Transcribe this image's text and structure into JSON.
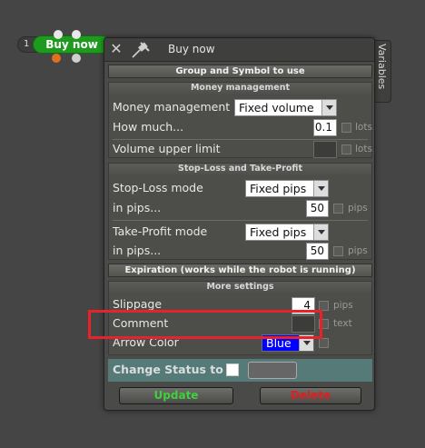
{
  "node": {
    "index": "1",
    "label": "Buy now"
  },
  "window": {
    "title": "Buy now",
    "side_tab": "Variables"
  },
  "sections": {
    "group_symbol": "Group and Symbol to use",
    "money": {
      "title": "Money management",
      "money_mgmt_label": "Money management",
      "money_mgmt_value": "Fixed volume",
      "how_much_label": "How much...",
      "how_much_value": "0.1",
      "how_much_unit": "lots",
      "volume_limit_label": "Volume upper limit",
      "volume_limit_unit": "lots"
    },
    "sltp": {
      "title": "Stop-Loss and Take-Profit",
      "sl_mode_label": "Stop-Loss mode",
      "sl_mode_value": "Fixed pips",
      "sl_pips_label": "in pips...",
      "sl_pips_value": "50",
      "sl_unit": "pips",
      "tp_mode_label": "Take-Profit mode",
      "tp_mode_value": "Fixed pips",
      "tp_pips_label": "in pips...",
      "tp_pips_value": "50",
      "tp_unit": "pips"
    },
    "expiration": "Expiration (works while the robot is running)",
    "more": {
      "title": "More settings",
      "slippage_label": "Slippage",
      "slippage_value": "4",
      "slippage_unit": "pips",
      "comment_label": "Comment",
      "comment_unit": "text",
      "arrow_label": "Arrow Color",
      "arrow_value": "Blue"
    }
  },
  "status": {
    "label": "Change Status to"
  },
  "buttons": {
    "update": "Update",
    "delete": "Delete"
  },
  "colors": {
    "node": "#1e9b1e",
    "highlight": "#e8222a",
    "arrow_color": "#0000ff",
    "update_text": "#3fcf3f",
    "delete_text": "#e01e1e"
  }
}
